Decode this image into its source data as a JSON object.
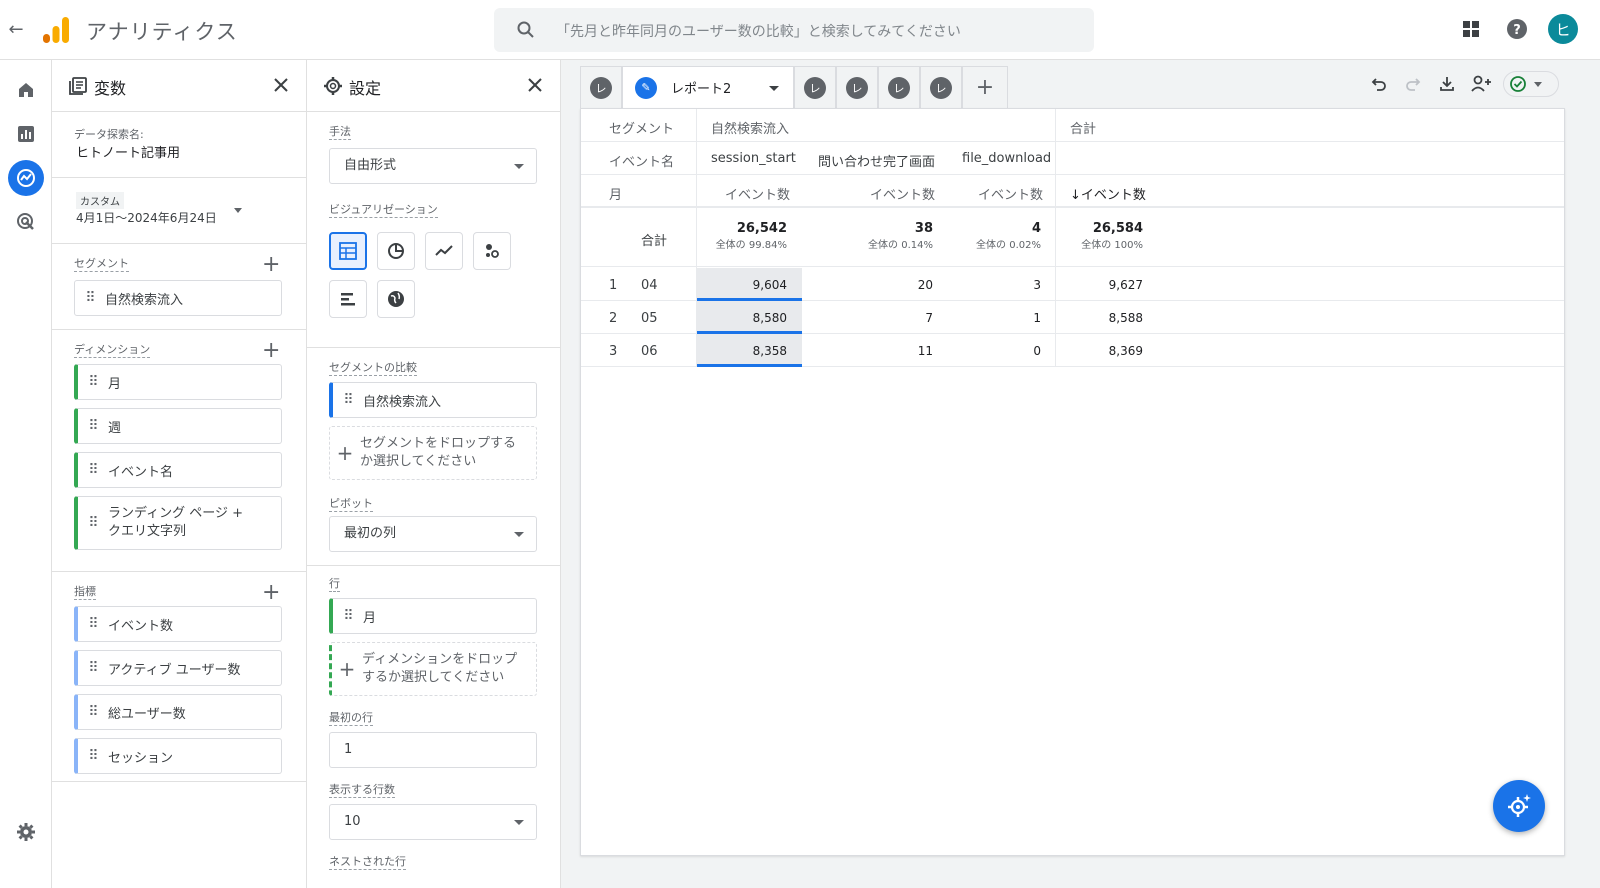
{
  "app": {
    "title": "アナリティクス",
    "search_placeholder": "「先月と昨年同月のユーザー数の比較」と検索してみてください",
    "avatar_initial": "ヒ"
  },
  "variables_panel": {
    "title": "変数",
    "exploration_name_label": "データ探索名:",
    "exploration_name": "ヒトノート記事用",
    "date_tag": "カスタム",
    "date_range": "4月1日〜2024年6月24日",
    "segments_label": "セグメント",
    "segments": [
      "自然検索流入"
    ],
    "dimensions_label": "ディメンション",
    "dimensions": [
      "月",
      "週",
      "イベント名",
      "ランディング ページ + クエリ文字列"
    ],
    "metrics_label": "指標",
    "metrics": [
      "イベント数",
      "アクティブ ユーザー数",
      "総ユーザー数",
      "セッション"
    ]
  },
  "settings_panel": {
    "title": "設定",
    "technique_label": "手法",
    "technique_value": "自由形式",
    "visualization_label": "ビジュアリゼーション",
    "segment_compare_label": "セグメントの比較",
    "segment_compare": "自然検索流入",
    "segment_drop": "セグメントをドロップするか選択してください",
    "pivot_label": "ピボット",
    "pivot_value": "最初の列",
    "rows_label": "行",
    "rows_item": "月",
    "rows_drop": "ディメンションをドロップするか選択してください",
    "first_row_label": "最初の行",
    "first_row_value": "1",
    "show_rows_label": "表示する行数",
    "show_rows_value": "10",
    "nested_rows_label": "ネストされた行"
  },
  "tabs": {
    "active_name": "レポート2",
    "tab_glyph": "レ"
  },
  "table": {
    "segment_header": "セグメント",
    "segment_value": "自然検索流入",
    "total_header": "合計",
    "event_name_header": "イベント名",
    "event_names": [
      "session_start",
      "問い合わせ完了画面",
      "file_download"
    ],
    "month_header": "月",
    "metric_header": "イベント数",
    "sorted_metric_header": "↓イベント数",
    "totals_label": "合計",
    "totals": [
      {
        "value": "26,542",
        "share": "全体の 99.84%"
      },
      {
        "value": "38",
        "share": "全体の 0.14%"
      },
      {
        "value": "4",
        "share": "全体の 0.02%"
      },
      {
        "value": "26,584",
        "share": "全体の 100%"
      }
    ],
    "rows": [
      {
        "index": "1",
        "month": "04",
        "values": [
          "9,604",
          "20",
          "3",
          "9,627"
        ]
      },
      {
        "index": "2",
        "month": "05",
        "values": [
          "8,580",
          "7",
          "1",
          "8,588"
        ]
      },
      {
        "index": "3",
        "month": "06",
        "values": [
          "8,358",
          "11",
          "0",
          "8,369"
        ]
      }
    ]
  }
}
